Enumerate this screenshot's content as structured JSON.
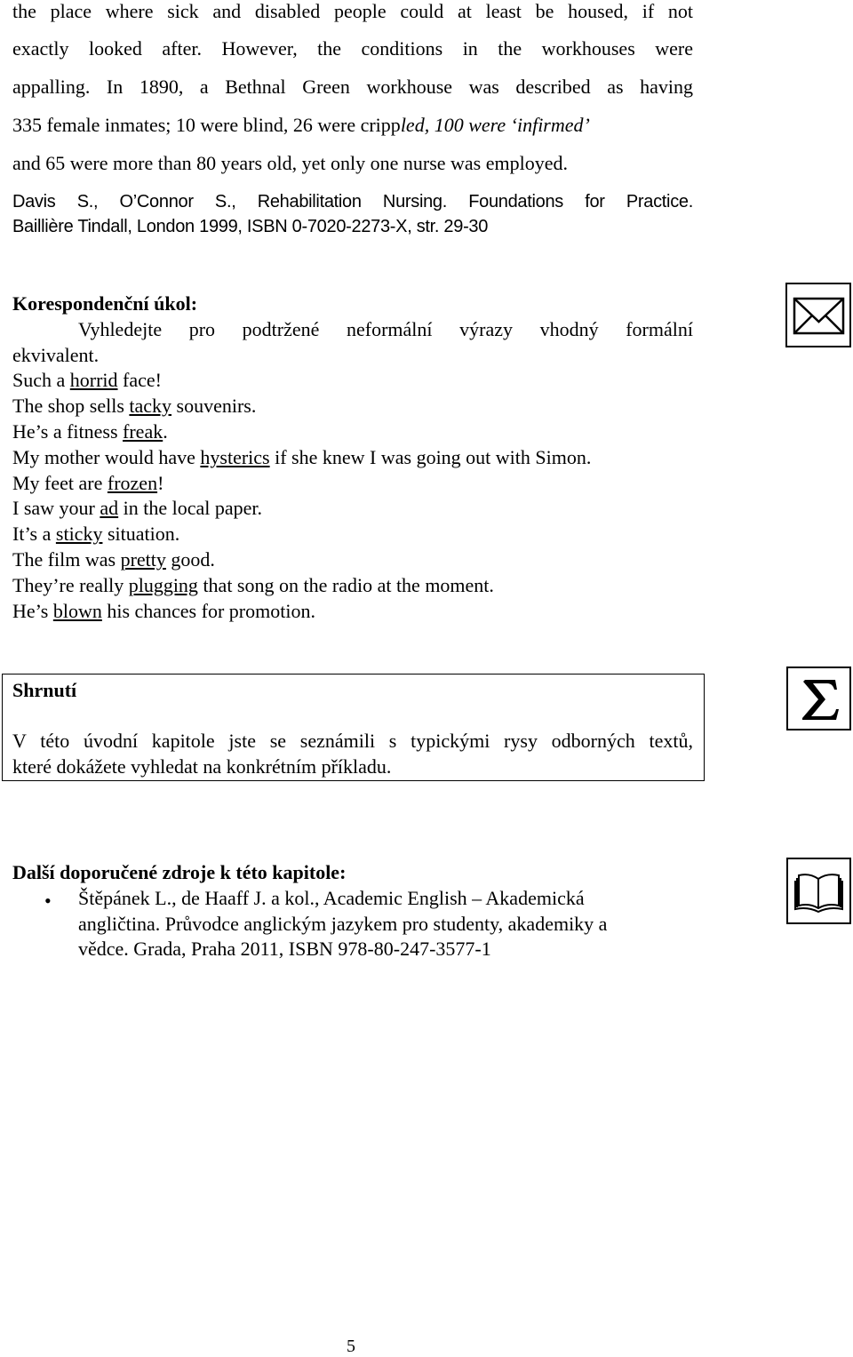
{
  "quote": {
    "lines": [
      "the place where sick and disabled people could at least be housed, if not",
      "exactly looked after. However, the conditions in the workhouses were",
      "appalling. In 1890, a Bethnal Green workhouse was described as having"
    ],
    "line4_normal": "335 female inmates; 10 were blind, 26 were cripp",
    "line4_italic": "led, 100 were ‘infirmed’",
    "line5": "and 65 were more than 80 years old, yet only one nurse was employed."
  },
  "citation": {
    "line1": "Davis S., O’Connor S., Rehabilitation Nursing. Foundations for Practice.",
    "line2": "Baillière Tindall, London 1999, ISBN 0-7020-2273-X, str. 29-30"
  },
  "task": {
    "heading": "Korespondenční úkol:",
    "instruction_line1": "Vyhledejte pro podtržené neformální výrazy vhodný formální",
    "instruction_line2": "ekvivalent.",
    "icon": "envelope-icon",
    "examples": [
      {
        "pre": "Such a ",
        "u": "horrid",
        "post": " face!"
      },
      {
        "pre": "The shop sells ",
        "u": "tacky",
        "post": " souvenirs."
      },
      {
        "pre": "He’s a fitness ",
        "u": "freak",
        "post": "."
      },
      {
        "pre": "My mother would have ",
        "u": "hysterics",
        "post": " if she knew I was going out with Simon."
      },
      {
        "pre": "My feet are ",
        "u": "frozen",
        "post": "!"
      },
      {
        "pre": "I saw your ",
        "u": "ad",
        "post": " in the local paper."
      },
      {
        "pre": "It’s a ",
        "u": "sticky",
        "post": " situation."
      },
      {
        "pre": "The film was ",
        "u": "pretty",
        "post": " good."
      },
      {
        "pre": "They’re really ",
        "u": "plugging",
        "post": " that song on the radio at the moment."
      },
      {
        "pre": "He’s ",
        "u": "blown",
        "post": " his chances for promotion."
      }
    ]
  },
  "summary": {
    "heading": "Shrnutí",
    "line1": "V této úvodní kapitole jste se seznámili s typickými rysy odborných textů,",
    "line2": "které dokážete vyhledat na konkrétním příkladu.",
    "icon": "sigma-icon"
  },
  "sources": {
    "heading": "Další doporučené zdroje k této kapitole:",
    "bullet": "•",
    "item_lines": [
      "Štěpánek L., de Haaff J. a kol., Academic English – Akademická",
      "angličtina. Průvodce anglickým jazykem pro studenty, akademiky a",
      "vědce. Grada, Praha 2011, ISBN 978-80-247-3577-1"
    ],
    "icon": "book-icon"
  },
  "page_number": "5"
}
